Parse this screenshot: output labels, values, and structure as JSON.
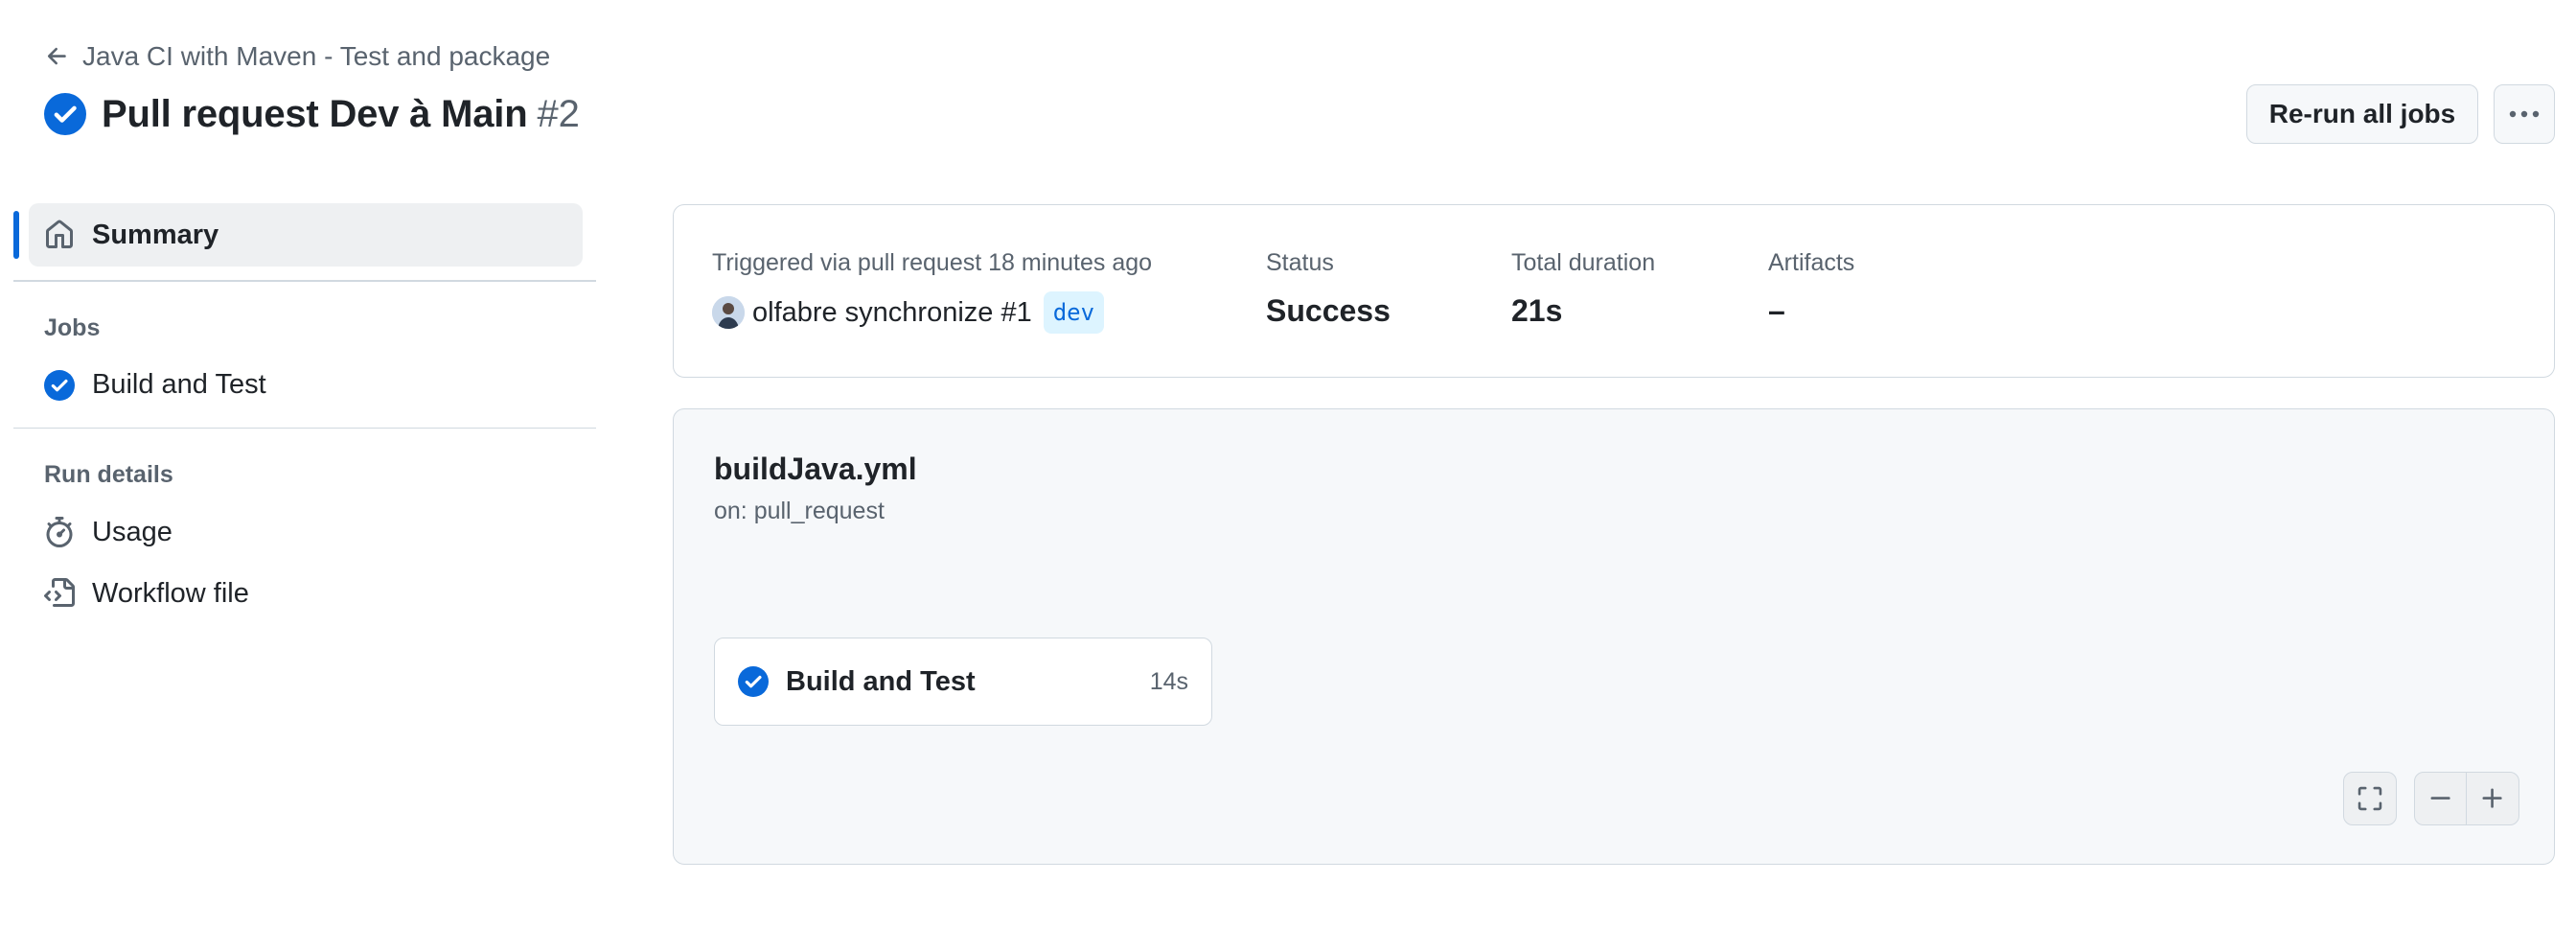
{
  "header": {
    "back_label": "Java CI with Maven - Test and package",
    "title": "Pull request Dev à Main",
    "run_number": "#2",
    "rerun_label": "Re-run all jobs"
  },
  "sidebar": {
    "summary_label": "Summary",
    "jobs_heading": "Jobs",
    "jobs": [
      {
        "label": "Build and Test",
        "status": "success"
      }
    ],
    "run_details_heading": "Run details",
    "usage_label": "Usage",
    "workflow_file_label": "Workflow file"
  },
  "summary": {
    "trigger_text": "Triggered via pull request 18 minutes ago",
    "actor": "olfabre",
    "event_text": "synchronize #1",
    "branch": "dev",
    "status_label": "Status",
    "status_value": "Success",
    "duration_label": "Total duration",
    "duration_value": "21s",
    "artifacts_label": "Artifacts",
    "artifacts_value": "–"
  },
  "workflow": {
    "file": "buildJava.yml",
    "trigger": "on: pull_request",
    "jobs": [
      {
        "name": "Build and Test",
        "duration": "14s",
        "status": "success"
      }
    ]
  },
  "icons": {
    "success": "check-circle-fill",
    "back": "arrow-left",
    "summary": "home",
    "usage": "stopwatch",
    "workflow_file": "file-code",
    "more": "kebab-horizontal",
    "fullscreen": "screen-full",
    "zoom_out": "dash",
    "zoom_in": "plus"
  },
  "colors": {
    "accent": "#0969da",
    "success_check": "#0969da",
    "text_primary": "#1f2328",
    "text_muted": "#59636e",
    "border": "#d1d9e0",
    "canvas_subtle": "#f6f8fa"
  }
}
